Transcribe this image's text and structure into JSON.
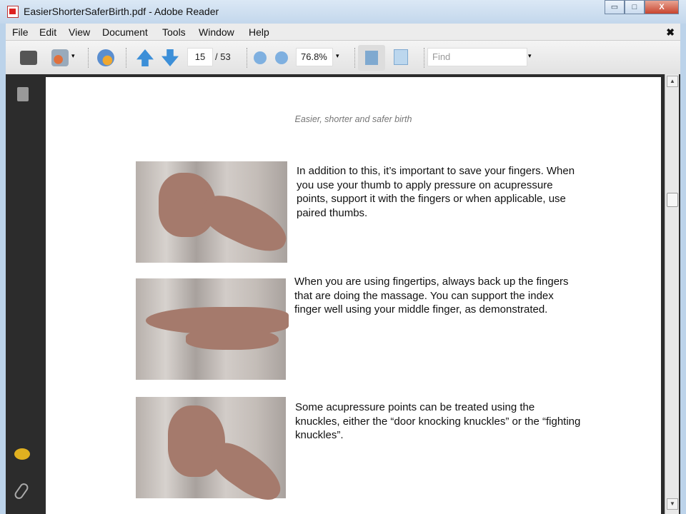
{
  "window": {
    "title": "EasierShorterSaferBirth.pdf - Adobe Reader",
    "minimize": "▭",
    "maximize": "□",
    "close": "X"
  },
  "menu": [
    "File",
    "Edit",
    "View",
    "Document",
    "Tools",
    "Window",
    "Help"
  ],
  "menu_close": "✖",
  "toolbar": {
    "page_current": "15",
    "page_total": "/ 53",
    "zoom": "76.8%",
    "find_placeholder": "Find",
    "dropdown": "▾"
  },
  "document": {
    "header": "Easier, shorter and safer birth",
    "paragraphs": [
      "In addition to this, it’s important to save your fingers. When you use your thumb to apply pressure on acupressure points, support it with the fingers or when applicable, use paired thumbs.",
      "When you are using fingertips, always back up the fingers that are doing the massage. You can support the index finger well using your middle finger, as demonstrated.",
      "Some acupressure points can be treated using the knuckles, either the “door knocking knuckles” or the “fighting knuckles”."
    ]
  },
  "scroll": {
    "up": "▲",
    "down": "▼"
  }
}
